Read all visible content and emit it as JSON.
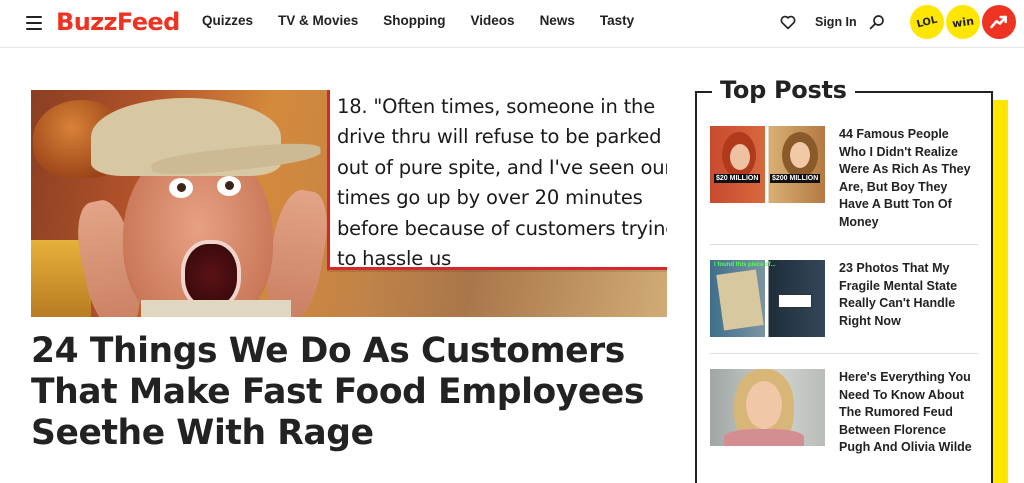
{
  "header": {
    "logo": "BuzzFeed",
    "nav": [
      "Quizzes",
      "TV & Movies",
      "Shopping",
      "Videos",
      "News",
      "Tasty"
    ],
    "sign_in": "Sign In",
    "badges": {
      "lol": "LOL",
      "win": "win"
    },
    "icons": [
      "hamburger-menu-icon",
      "heart-icon",
      "search-icon",
      "trending-icon"
    ]
  },
  "hero": {
    "quote": "18. \"Often times, someone in the drive thru will refuse to be parked out of pure spite, and I've seen our times go up by over 20 minutes before because of customers trying to hassle us",
    "title": "24 Things We Do As Customers That Make Fast Food Employees Seethe With Rage"
  },
  "top_posts": {
    "heading": "Top Posts",
    "items": [
      {
        "title": "44 Famous People Who I Didn't Realize Were As Rich As They Are, But Boy They Have A Butt Ton Of Money",
        "thumb_tags": [
          "$20 MILLION",
          "$200 MILLION"
        ]
      },
      {
        "title": "23 Photos That My Fragile Mental State Really Can't Handle Right Now",
        "thumb_tags": [
          "I found this piece of..."
        ]
      },
      {
        "title": "Here's Everything You Need To Know About The Rumored Feud Between Florence Pugh And Olivia Wilde",
        "thumb_tags": []
      }
    ]
  },
  "colors": {
    "brand_red": "#ee3322",
    "accent_yellow": "#ffe600",
    "text": "#222222"
  }
}
